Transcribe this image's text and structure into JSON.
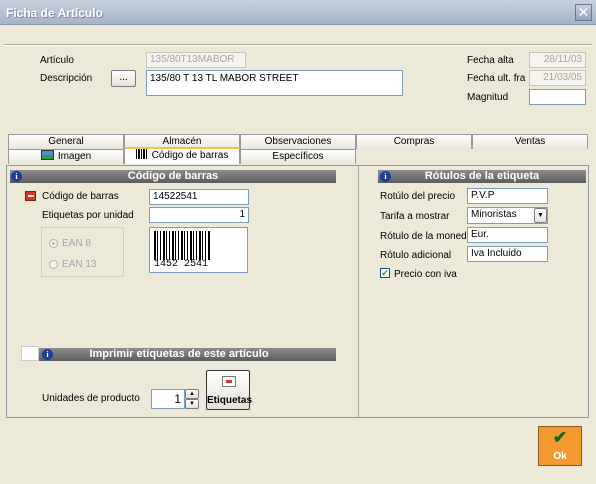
{
  "window": {
    "title": "Ficha de Artículo",
    "close_icon": "close-icon"
  },
  "article": {
    "articulo_label": "Artículo",
    "articulo_value": "135/80T13MABOR",
    "descripcion_label": "Descripción",
    "descripcion_button": "...",
    "descripcion_value": "135/80 T 13 TL MABOR STREET",
    "fecha_alta_label": "Fecha alta",
    "fecha_alta_value": "28/11/03",
    "fecha_ult_label": "Fecha ult. fra",
    "fecha_ult_value": "21/03/05",
    "magnitud_label": "Magnitud",
    "magnitud_value": ""
  },
  "tabs": {
    "row1": [
      "General",
      "Almacén",
      "Observaciones",
      "Compras",
      "Ventas"
    ],
    "row2": [
      "Imagen",
      "Código de barras",
      "Específicos"
    ],
    "active": "Código de barras"
  },
  "barcode_section": {
    "header": "Código de barras",
    "codigo_label": "Código de barras",
    "codigo_value": "14522541",
    "etiquetas_label": "Etiquetas por unidad",
    "etiquetas_value": "1",
    "ean8_label": "EAN 8",
    "ean13_label": "EAN 13",
    "barcode_text": "1452 2541",
    "selected_type": "EAN 8"
  },
  "rotulos_section": {
    "header": "Rótulos de la etiqueta",
    "rotulo_precio_label": "Rotúlo del precio",
    "rotulo_precio_value": "P.V.P",
    "tarifa_label": "Tarifa a mostrar",
    "tarifa_value": "Minoristas",
    "moneda_label": "Rótulo de la moneda",
    "moneda_value": "Eur.",
    "adicional_label": "Rótulo adicional",
    "adicional_value": "Iva Incluido",
    "precio_iva_label": "Precio con iva",
    "precio_iva_checked": true
  },
  "print_section": {
    "header": "Imprimir etiquetas de este artículo",
    "unidades_label": "Unidades de producto",
    "unidades_value": "1",
    "etiquetas_button": "Etiquetas"
  },
  "footer": {
    "ok_button": "Ok"
  },
  "colors": {
    "accent": "#f4c24a",
    "ok_bg": "#f29a2e",
    "header_bg": "#6e6e6e"
  }
}
